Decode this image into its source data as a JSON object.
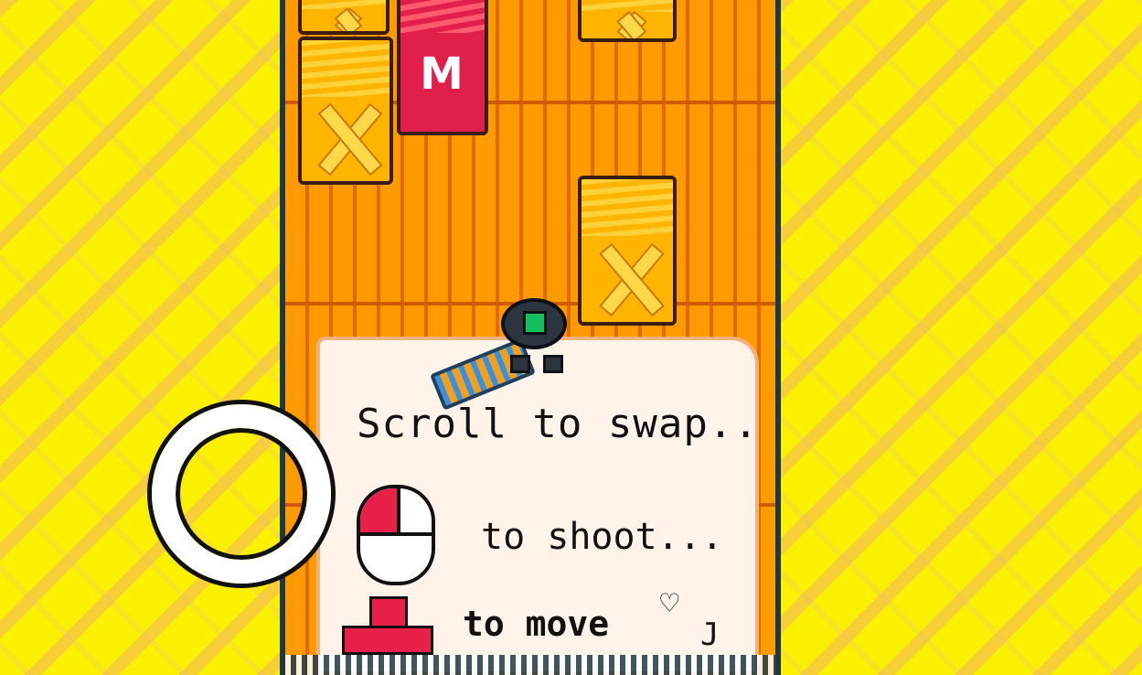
{
  "tutorial": {
    "line_scroll": "Scroll to swap..",
    "line_shoot": "to shoot...",
    "line_move": "to move",
    "heart": "♡",
    "signature": "J"
  },
  "crate_glyph": "M",
  "colors": {
    "background_yellow": "#fbf000",
    "floor_orange": "#ffa000",
    "crate": "#ffb400",
    "tnt_red": "#e0204a",
    "panel": "#fff3ea",
    "robot_eye": "#14c060"
  }
}
